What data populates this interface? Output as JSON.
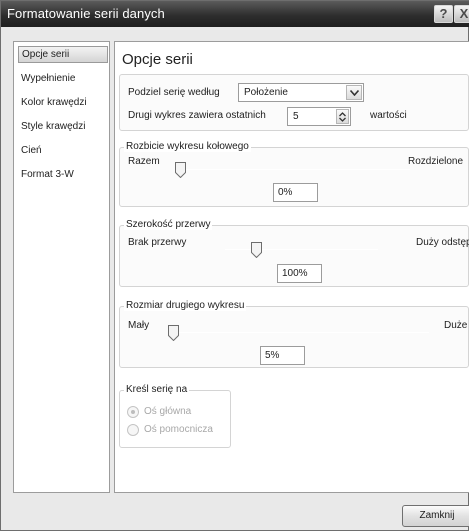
{
  "window": {
    "title": "Formatowanie serii danych"
  },
  "titlebar": {
    "help_glyph": "?",
    "close_glyph": "X"
  },
  "sidebar": {
    "items": [
      {
        "label": "Opcje serii",
        "selected": true
      },
      {
        "label": "Wypełnienie",
        "selected": false
      },
      {
        "label": "Kolor krawędzi",
        "selected": false
      },
      {
        "label": "Style krawędzi",
        "selected": false
      },
      {
        "label": "Cień",
        "selected": false
      },
      {
        "label": "Format 3-W",
        "selected": false
      }
    ]
  },
  "panel": {
    "title": "Opcje serii",
    "split": {
      "label": "Podziel serię według",
      "value": "Położenie",
      "second_label": "Drugi wykres zawiera ostatnich",
      "second_value": "5",
      "second_unit": "wartości"
    },
    "explosion": {
      "legend": "Rozbicie wykresu kołowego",
      "min_label": "Razem",
      "max_label": "Rozdzielone",
      "value": "0%",
      "level": 0.0
    },
    "gap": {
      "legend": "Szerokość przerwy",
      "min_label": "Brak przerwy",
      "max_label": "Duży odstęp",
      "value": "100%",
      "level": 0.2
    },
    "second_size": {
      "legend": "Rozmiar drugiego wykresu",
      "min_label": "Mały",
      "max_label": "Duże",
      "value": "5%",
      "level": 0.0
    },
    "plot_on": {
      "legend": "Kreśl serię na",
      "options": [
        {
          "label": "Oś główna",
          "selected": true,
          "enabled": false
        },
        {
          "label": "Oś pomocnicza",
          "selected": false,
          "enabled": false
        }
      ]
    }
  },
  "footer": {
    "close_label": "Zamknij"
  }
}
